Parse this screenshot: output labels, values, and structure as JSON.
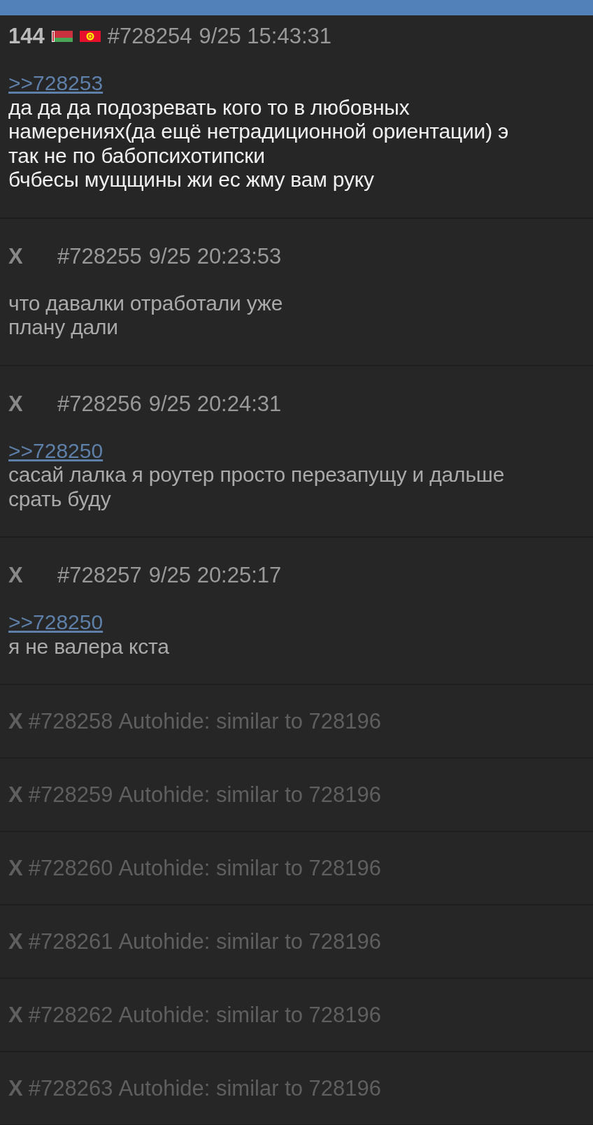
{
  "posts": [
    {
      "kind": "post",
      "name": "144",
      "new": true,
      "flags": [
        {
          "kind": "striped"
        },
        {
          "kind": "sun"
        }
      ],
      "number": "#728254",
      "date": "9/25 15:43:31",
      "reply": ">>728253",
      "lines": [
        "да да да подозревать кого то в любовных",
        "намерениях(да ещё нетрадиционной ориентации) э",
        "так не по бабопсихотипски",
        "бчбесы мущщины жи ес жму вам руку"
      ]
    },
    {
      "kind": "post",
      "name": "X",
      "new": false,
      "number": "#728255",
      "date": "9/25 20:23:53",
      "lines": [
        "что давалки отработали уже",
        "плану дали"
      ]
    },
    {
      "kind": "post",
      "name": "X",
      "new": false,
      "number": "#728256",
      "date": "9/25 20:24:31",
      "reply": ">>728250",
      "lines": [
        "сасай лалка я роутер просто перезапущу и дальше",
        "срать буду"
      ]
    },
    {
      "kind": "post",
      "name": "X",
      "new": false,
      "number": "#728257",
      "date": "9/25 20:25:17",
      "reply": ">>728250",
      "lines": [
        "я не валера кста"
      ]
    },
    {
      "kind": "hidden",
      "name": "X",
      "number": "#728258",
      "note": "Autohide: similar to 728196"
    },
    {
      "kind": "hidden",
      "name": "X",
      "number": "#728259",
      "note": "Autohide: similar to 728196"
    },
    {
      "kind": "hidden",
      "name": "X",
      "number": "#728260",
      "note": "Autohide: similar to 728196"
    },
    {
      "kind": "hidden",
      "name": "X",
      "number": "#728261",
      "note": "Autohide: similar to 728196"
    },
    {
      "kind": "hidden",
      "name": "X",
      "number": "#728262",
      "note": "Autohide: similar to 728196"
    },
    {
      "kind": "hidden",
      "name": "X",
      "number": "#728263",
      "note": "Autohide: similar to 728196"
    }
  ]
}
